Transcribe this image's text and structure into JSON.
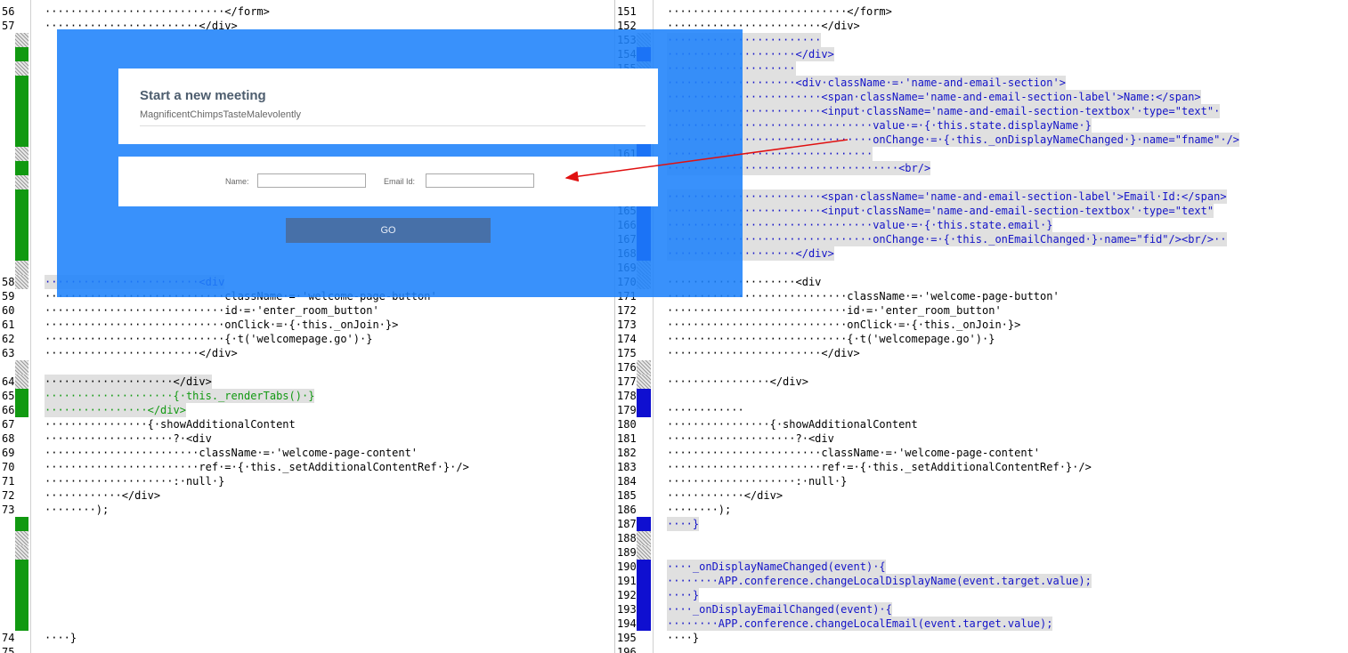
{
  "left_lines": [
    {
      "ln": "56",
      "code": "····························</form>",
      "mark": "",
      "hl": false,
      "color": "black"
    },
    {
      "ln": "57",
      "code": "························</div>",
      "mark": "",
      "hl": false,
      "color": "black"
    },
    {
      "ln": "",
      "code": "",
      "mark": "hatch",
      "hl": false,
      "color": "black"
    },
    {
      "ln": "",
      "code": "",
      "mark": "green",
      "hl": false,
      "color": "black"
    },
    {
      "ln": "",
      "code": "",
      "mark": "hatch",
      "hl": false,
      "color": "black"
    },
    {
      "ln": "",
      "code": "",
      "mark": "green",
      "hl": false,
      "color": "black"
    },
    {
      "ln": "",
      "code": "",
      "mark": "green",
      "hl": false,
      "color": "black"
    },
    {
      "ln": "",
      "code": "",
      "mark": "green",
      "hl": false,
      "color": "black"
    },
    {
      "ln": "",
      "code": "",
      "mark": "green",
      "hl": false,
      "color": "black"
    },
    {
      "ln": "",
      "code": "",
      "mark": "green",
      "hl": false,
      "color": "black"
    },
    {
      "ln": "",
      "code": "",
      "mark": "hatch",
      "hl": false,
      "color": "black"
    },
    {
      "ln": "",
      "code": "",
      "mark": "green",
      "hl": false,
      "color": "black"
    },
    {
      "ln": "",
      "code": "",
      "mark": "hatch",
      "hl": false,
      "color": "black"
    },
    {
      "ln": "",
      "code": "",
      "mark": "green",
      "hl": false,
      "color": "black"
    },
    {
      "ln": "",
      "code": "",
      "mark": "green",
      "hl": false,
      "color": "black"
    },
    {
      "ln": "",
      "code": "",
      "mark": "green",
      "hl": false,
      "color": "black"
    },
    {
      "ln": "",
      "code": "",
      "mark": "green",
      "hl": false,
      "color": "black"
    },
    {
      "ln": "",
      "code": "",
      "mark": "green",
      "hl": false,
      "color": "black"
    },
    {
      "ln": "",
      "code": "",
      "mark": "hatch",
      "hl": false,
      "color": "black"
    },
    {
      "ln": "58",
      "code": "························<div",
      "mark": "hatch",
      "hl": true,
      "color": "blue"
    },
    {
      "ln": "59",
      "code": "····························className·=·'welcome-page-button'",
      "mark": "",
      "hl": false,
      "color": "black"
    },
    {
      "ln": "60",
      "code": "····························id·=·'enter_room_button'",
      "mark": "",
      "hl": false,
      "color": "black"
    },
    {
      "ln": "61",
      "code": "····························onClick·=·{·this._onJoin·}>",
      "mark": "",
      "hl": false,
      "color": "black"
    },
    {
      "ln": "62",
      "code": "····························{·t('welcomepage.go')·}",
      "mark": "",
      "hl": false,
      "color": "black"
    },
    {
      "ln": "63",
      "code": "························</div>",
      "mark": "",
      "hl": false,
      "color": "black"
    },
    {
      "ln": "",
      "code": "",
      "mark": "hatch",
      "hl": false,
      "color": "black"
    },
    {
      "ln": "64",
      "code": "····················</div>",
      "mark": "hatch",
      "hl": true,
      "color": "black"
    },
    {
      "ln": "65",
      "code": "····················{·this._renderTabs()·}",
      "mark": "green",
      "hl": true,
      "color": "green"
    },
    {
      "ln": "66",
      "code": "················</div>",
      "mark": "green",
      "hl": true,
      "color": "green"
    },
    {
      "ln": "67",
      "code": "················{·showAdditionalContent",
      "mark": "",
      "hl": false,
      "color": "black"
    },
    {
      "ln": "68",
      "code": "····················?·<div",
      "mark": "",
      "hl": false,
      "color": "black"
    },
    {
      "ln": "69",
      "code": "························className·=·'welcome-page-content'",
      "mark": "",
      "hl": false,
      "color": "black"
    },
    {
      "ln": "70",
      "code": "························ref·=·{·this._setAdditionalContentRef·}·/>",
      "mark": "",
      "hl": false,
      "color": "black"
    },
    {
      "ln": "71",
      "code": "····················:·null·}",
      "mark": "",
      "hl": false,
      "color": "black"
    },
    {
      "ln": "72",
      "code": "············</div>",
      "mark": "",
      "hl": false,
      "color": "black"
    },
    {
      "ln": "73",
      "code": "········);",
      "mark": "",
      "hl": false,
      "color": "black"
    },
    {
      "ln": "",
      "code": "",
      "mark": "green",
      "hl": false,
      "color": "black"
    },
    {
      "ln": "",
      "code": "",
      "mark": "hatch",
      "hl": false,
      "color": "black"
    },
    {
      "ln": "",
      "code": "",
      "mark": "hatch",
      "hl": false,
      "color": "black"
    },
    {
      "ln": "",
      "code": "",
      "mark": "green",
      "hl": false,
      "color": "black"
    },
    {
      "ln": "",
      "code": "",
      "mark": "green",
      "hl": false,
      "color": "black"
    },
    {
      "ln": "",
      "code": "",
      "mark": "green",
      "hl": false,
      "color": "black"
    },
    {
      "ln": "",
      "code": "",
      "mark": "green",
      "hl": false,
      "color": "black"
    },
    {
      "ln": "",
      "code": "",
      "mark": "green",
      "hl": false,
      "color": "black"
    },
    {
      "ln": "74",
      "code": "····}",
      "mark": "",
      "hl": false,
      "color": "black"
    },
    {
      "ln": "75",
      "code": "",
      "mark": "",
      "hl": false,
      "color": "black"
    }
  ],
  "right_lines": [
    {
      "ln": "151",
      "code": "····························</form>",
      "mark": "",
      "hl": false,
      "color": "black"
    },
    {
      "ln": "152",
      "code": "························</div>",
      "mark": "",
      "hl": false,
      "color": "black"
    },
    {
      "ln": "153",
      "code": "························",
      "mark": "hatch",
      "hl": true,
      "color": "blue"
    },
    {
      "ln": "154",
      "code": "····················</div>",
      "mark": "blue",
      "hl": true,
      "color": "blue"
    },
    {
      "ln": "155",
      "code": "····················",
      "mark": "hatch",
      "hl": true,
      "color": "blue"
    },
    {
      "ln": "156",
      "code": "····················<div·className·=·'name-and-email-section'>",
      "mark": "blue",
      "hl": true,
      "color": "blue"
    },
    {
      "ln": "157",
      "code": "························<span·className='name-and-email-section-label'>Name:</span>",
      "mark": "blue",
      "hl": true,
      "color": "blue"
    },
    {
      "ln": "158",
      "code": "························<input·className='name-and-email-section-textbox'·type=\"text\"·",
      "mark": "blue",
      "hl": true,
      "color": "blue"
    },
    {
      "ln": "159",
      "code": "································value·=·{·this.state.displayName·}",
      "mark": "blue",
      "hl": true,
      "color": "blue"
    },
    {
      "ln": "160",
      "code": "································onChange·=·{·this._onDisplayNameChanged·}·name=\"fname\"·/>",
      "mark": "blue",
      "hl": true,
      "color": "blue"
    },
    {
      "ln": "161",
      "code": "································",
      "mark": "blue",
      "hl": true,
      "color": "blue"
    },
    {
      "ln": "162",
      "code": "····································<br/>",
      "mark": "blue",
      "hl": true,
      "color": "blue"
    },
    {
      "ln": "163",
      "code": "",
      "mark": "hatch",
      "hl": false,
      "color": "blue"
    },
    {
      "ln": "164",
      "code": "························<span·className='name-and-email-section-label'>Email·Id:</span>",
      "mark": "blue",
      "hl": true,
      "color": "blue"
    },
    {
      "ln": "165",
      "code": "························<input·className='name-and-email-section-textbox'·type=\"text\"",
      "mark": "blue",
      "hl": true,
      "color": "blue"
    },
    {
      "ln": "166",
      "code": "································value·=·{·this.state.email·}",
      "mark": "blue",
      "hl": true,
      "color": "blue"
    },
    {
      "ln": "167",
      "code": "································onChange·=·{·this._onEmailChanged·}·name=\"fid\"/><br/>··",
      "mark": "blue",
      "hl": true,
      "color": "blue"
    },
    {
      "ln": "168",
      "code": "····················</div>",
      "mark": "blue",
      "hl": true,
      "color": "blue"
    },
    {
      "ln": "169",
      "code": "",
      "mark": "hatch",
      "hl": false,
      "color": "blue"
    },
    {
      "ln": "170",
      "code": "····················<div",
      "mark": "hatch",
      "hl": false,
      "color": "black"
    },
    {
      "ln": "171",
      "code": "····························className·=·'welcome-page-button'",
      "mark": "",
      "hl": false,
      "color": "black"
    },
    {
      "ln": "172",
      "code": "····························id·=·'enter_room_button'",
      "mark": "",
      "hl": false,
      "color": "black"
    },
    {
      "ln": "173",
      "code": "····························onClick·=·{·this._onJoin·}>",
      "mark": "",
      "hl": false,
      "color": "black"
    },
    {
      "ln": "174",
      "code": "····························{·t('welcomepage.go')·}",
      "mark": "",
      "hl": false,
      "color": "black"
    },
    {
      "ln": "175",
      "code": "························</div>",
      "mark": "",
      "hl": false,
      "color": "black"
    },
    {
      "ln": "176",
      "code": "",
      "mark": "hatch",
      "hl": false,
      "color": "black"
    },
    {
      "ln": "177",
      "code": "················</div>",
      "mark": "hatch",
      "hl": false,
      "color": "black"
    },
    {
      "ln": "178",
      "code": "",
      "mark": "blue",
      "hl": false,
      "color": "black"
    },
    {
      "ln": "179",
      "code": "············",
      "mark": "blue",
      "hl": false,
      "color": "black"
    },
    {
      "ln": "180",
      "code": "················{·showAdditionalContent",
      "mark": "",
      "hl": false,
      "color": "black"
    },
    {
      "ln": "181",
      "code": "····················?·<div",
      "mark": "",
      "hl": false,
      "color": "black"
    },
    {
      "ln": "182",
      "code": "························className·=·'welcome-page-content'",
      "mark": "",
      "hl": false,
      "color": "black"
    },
    {
      "ln": "183",
      "code": "························ref·=·{·this._setAdditionalContentRef·}·/>",
      "mark": "",
      "hl": false,
      "color": "black"
    },
    {
      "ln": "184",
      "code": "····················:·null·}",
      "mark": "",
      "hl": false,
      "color": "black"
    },
    {
      "ln": "185",
      "code": "············</div>",
      "mark": "",
      "hl": false,
      "color": "black"
    },
    {
      "ln": "186",
      "code": "········);",
      "mark": "",
      "hl": false,
      "color": "black"
    },
    {
      "ln": "187",
      "code": "····}",
      "mark": "blue",
      "hl": true,
      "color": "blue"
    },
    {
      "ln": "188",
      "code": "",
      "mark": "hatch",
      "hl": false,
      "color": "blue"
    },
    {
      "ln": "189",
      "code": "",
      "mark": "hatch",
      "hl": false,
      "color": "blue"
    },
    {
      "ln": "190",
      "code": "····_onDisplayNameChanged(event)·{",
      "mark": "blue",
      "hl": true,
      "color": "blue"
    },
    {
      "ln": "191",
      "code": "········APP.conference.changeLocalDisplayName(event.target.value);",
      "mark": "blue",
      "hl": true,
      "color": "blue"
    },
    {
      "ln": "192",
      "code": "····}",
      "mark": "blue",
      "hl": true,
      "color": "blue"
    },
    {
      "ln": "193",
      "code": "····_onDisplayEmailChanged(event)·{",
      "mark": "blue",
      "hl": true,
      "color": "blue"
    },
    {
      "ln": "194",
      "code": "········APP.conference.changeLocalEmail(event.target.value);",
      "mark": "blue",
      "hl": true,
      "color": "blue"
    },
    {
      "ln": "195",
      "code": "····}",
      "mark": "",
      "hl": false,
      "color": "black"
    },
    {
      "ln": "196",
      "code": "",
      "mark": "",
      "hl": false,
      "color": "black"
    }
  ],
  "overlay": {
    "title": "Start a new meeting",
    "room_name": "MagnificentChimpsTasteMalevolently",
    "name_label": "Name:",
    "email_label": "Email Id:",
    "name_value": "",
    "email_value": "",
    "go_label": "GO"
  },
  "colors": {
    "overlay_blue": "#1e82fa",
    "go_button": "#4770a8",
    "diff_green": "#119911",
    "diff_blue": "#0f0fd0",
    "arrow_red": "#e01010"
  }
}
